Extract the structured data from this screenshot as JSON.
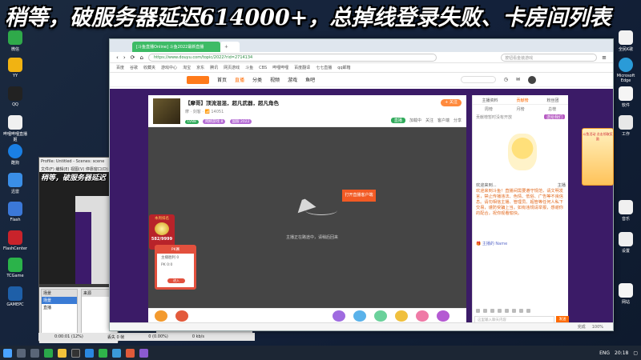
{
  "overlay": {
    "text": "稍等，破服务器延迟614000+，总掉线登录失败、卡房间列表"
  },
  "desktop": {
    "left_icons": [
      "微信",
      "YY",
      "QQ",
      "哔哩哔哩直播姬",
      "酷狗",
      "迅雷",
      "Flash",
      "FlashCenter",
      "TCGame",
      "GAMEPC"
    ],
    "right_icons": [
      "全民K歌",
      "Microsoft Edge",
      "软件",
      "工作",
      "音乐",
      "设置",
      "网站"
    ]
  },
  "obs": {
    "title": "Profile: Untitled - Scenes: scene",
    "menu": "文件(F)  编辑(E)  视图(V)  停靠窗口(D)",
    "preview_text": "稍等，破服务器延迟",
    "scenes_header": "场景",
    "sources_header": "来源",
    "scenes": [
      "场景",
      "直播"
    ],
    "controls": [
      "操作",
      "退出"
    ],
    "status": {
      "time": "0:00:01 (12%)",
      "dropped": "丢失 0 帧",
      "cpu": "0 (0.00%)",
      "kbs": "0 kb/s"
    }
  },
  "browser": {
    "tabs": [
      {
        "label": "[斗鱼直播Online] 斗鱼2022最新直播",
        "active": true
      },
      {
        "label": "",
        "active": false
      }
    ],
    "url": "https://www.douyu.com/topic/2022?rid=2714134",
    "search_placeholder": "按钮看金装游戏",
    "bookmarks": [
      "百度",
      "谷歌",
      "收藏夹",
      "游戏中心",
      "淘宝",
      "京东",
      "腾讯",
      "网页游戏",
      "斗鱼",
      "CBS",
      "哔哩哔哩",
      "百度翻译",
      "七七直播",
      "qq邮箱"
    ],
    "site": {
      "nav": [
        "首页",
        "直播",
        "分类",
        "视频",
        "游戏",
        "鱼吧"
      ],
      "active_nav": "直播"
    },
    "status_bar": [
      "完成",
      "100%"
    ]
  },
  "room": {
    "title": "【摩哥】顶流混混，超凡武器，超凡角色",
    "sub": "摩 · 剑客 · 📶 14051",
    "follow": "+ 关注",
    "tags": [
      {
        "text": "LV88",
        "color": "#2faa5a"
      },
      {
        "text": "网络游戏 8",
        "color": "#b46cd4"
      },
      {
        "text": "国服 2022",
        "color": "#b46cd4"
      }
    ],
    "actions": [
      "加载中",
      "关注",
      "客户端",
      "分享"
    ],
    "green_btn": "直播",
    "player": {
      "button": "打开直播客户端",
      "tip": "主播正在路途中，请稍后回来"
    }
  },
  "chat": {
    "tabs": [
      "主播资料",
      "贡献榜",
      "粉丝团"
    ],
    "sub_tabs": [
      "周榜",
      "月榜",
      "总榜"
    ],
    "rank_label": "贡献榜暂时没有开放",
    "open_btn": "送给我们",
    "notice_header": {
      "left": "欢迎来到...",
      "right": "主播"
    },
    "notice": "欢迎来到斗鱼！直播间需要遵守规范，请文明发言，禁止传播违法、色情、低俗、广告等不良信息。请勿相信主播、管理员、超管等任何人私下交易，谨防受骗上当。如有违规请举报，感谢你的配合，祝你观看愉快。",
    "message": "🎁 主播的 Name",
    "input_placeholder": "这里输入聊天内容",
    "send": "发送"
  },
  "rank_card": {
    "label": "本周排名",
    "score": "582/9999"
  },
  "pk_card": {
    "top": "PK赛",
    "lines": [
      "主播胜利 0",
      "PK 0:0"
    ],
    "button": "进入"
  },
  "right_ad": {
    "text": "斗鱼活动 点击领取奖励"
  },
  "taskbar": {
    "time": "20:18",
    "lang": "ENG",
    "icons": [
      "start",
      "search",
      "taskview",
      "browser",
      "folder",
      "obs",
      "qq",
      "wechat",
      "edge",
      "music",
      "game"
    ]
  }
}
